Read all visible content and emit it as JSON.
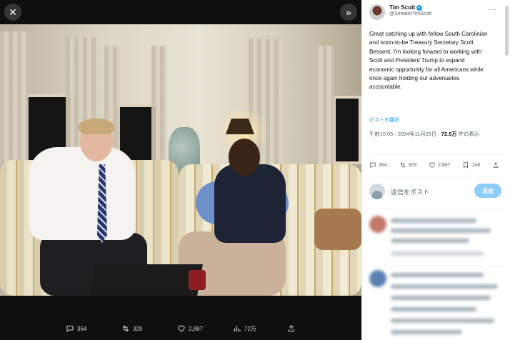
{
  "viewer": {
    "close_icon": "close-icon",
    "collapse_icon": "chevron-double-right-icon",
    "actions": {
      "reply_count": "364",
      "repost_count": "329",
      "like_count": "2,887",
      "view_count": "72万"
    }
  },
  "tweet": {
    "author_name": "Tim Scott",
    "handle": "@SenatorTimScott",
    "text": "Great catching up with fellow South Carolinian and soon-to-be Treasury Secretary Scott Bessent. I'm looking forward to working with Scott and President Trump to expand economic opportunity for all Americans while once again holding our adversaries accountable.",
    "translate_label": "ポストを翻訳",
    "timestamp": "午前10:05 · 2024年11月25日 · ",
    "views_bold": "72.9万",
    "views_suffix": " 件の表示",
    "engagement": {
      "replies": "364",
      "reposts": "329",
      "likes": "2,887",
      "bookmarks": "148"
    }
  },
  "reply_box": {
    "placeholder": "返信をポスト",
    "button_label": "返信"
  },
  "colors": {
    "accent": "#1d9bf0",
    "reply_button": "#8ecdf8",
    "viewer_bg": "#0f0f0f"
  }
}
